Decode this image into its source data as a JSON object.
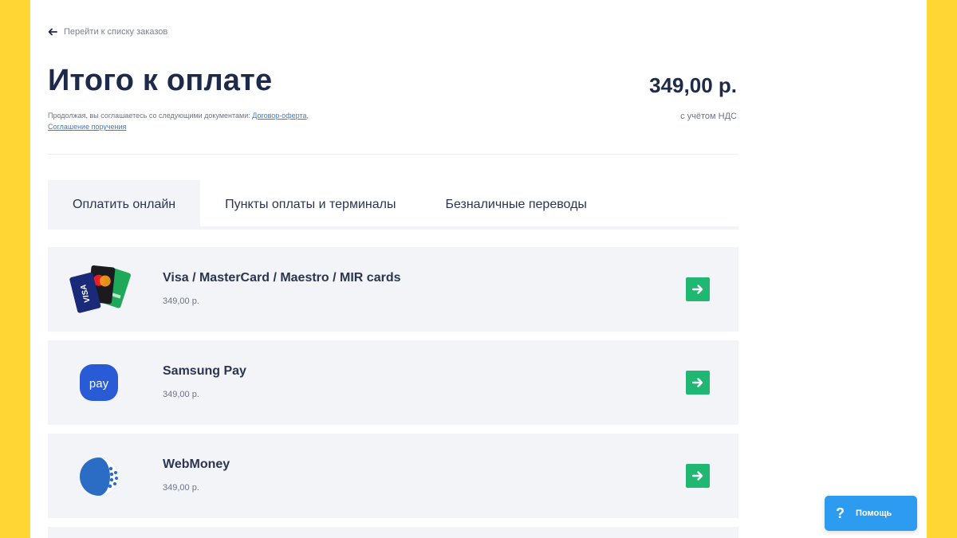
{
  "header": {
    "back_label": "Перейти к списку заказов",
    "title": "Итого к оплате",
    "agreement_text": "Продолжая, вы соглашаетесь со следующими документами:",
    "agreement_link_offer": "Договор-оферта",
    "agreement_link_assignment": "Соглашение поручения",
    "total": "349,00 р.",
    "vat_note": "с учётом НДС"
  },
  "tabs": [
    {
      "label": "Оплатить онлайн",
      "active": true
    },
    {
      "label": "Пункты оплаты и терминалы",
      "active": false
    },
    {
      "label": "Безналичные переводы",
      "active": false
    }
  ],
  "methods": [
    {
      "name": "Visa / MasterCard / Maestro / MIR cards",
      "price": "349,00 р.",
      "icon": "cards-icon"
    },
    {
      "name": "Samsung Pay",
      "price": "349,00 р.",
      "icon": "samsung-pay-icon"
    },
    {
      "name": "WebMoney",
      "price": "349,00 р.",
      "icon": "webmoney-icon"
    }
  ],
  "help": {
    "label": "Помощь",
    "icon_glyph": "?"
  },
  "colors": {
    "background": "#ffd633",
    "accent_green": "#1fb771",
    "help_blue": "#2d9cf0",
    "samsung_blue": "#2a5bd7",
    "webmoney_blue": "#2b6cc4",
    "title_navy": "#1e2a4a"
  },
  "logo_text": {
    "visa": "VISA",
    "pay": "pay"
  }
}
